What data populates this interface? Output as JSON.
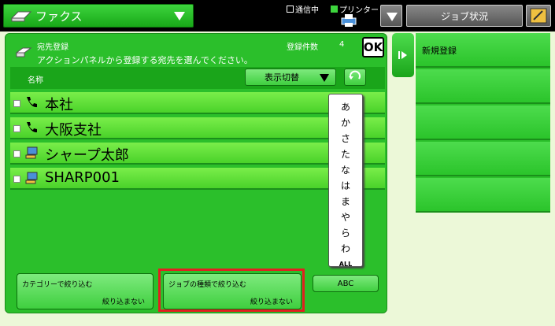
{
  "topbar": {
    "mode_label": "ファクス",
    "status_comm": "通信中",
    "status_printer": "プリンター",
    "job_status_label": "ジョブ状況"
  },
  "panel": {
    "title": "宛先登録",
    "subtitle": "アクションパネルから登録する宛先を選んでください。",
    "count_label": "登録件数",
    "count_value": "4",
    "ok_label": "OK",
    "column_label": "名称",
    "view_switch_label": "表示切替"
  },
  "rows": [
    {
      "name": "本社",
      "icon": "phone-icon"
    },
    {
      "name": "大阪支社",
      "icon": "phone-icon"
    },
    {
      "name": "シャープ太郎",
      "icon": "computer-icon"
    },
    {
      "name": "SHARP001",
      "icon": "computer-icon"
    }
  ],
  "kana_index": [
    "あ",
    "か",
    "さ",
    "た",
    "な",
    "は",
    "ま",
    "や",
    "ら",
    "わ",
    "ALL"
  ],
  "filters": {
    "category_title": "カテゴリーで絞り込む",
    "category_value": "絞り込まない",
    "jobtype_title": "ジョブの種類で絞り込む",
    "jobtype_value": "絞り込まない",
    "abc_label": "ABC"
  },
  "side": {
    "new_register_label": "新規登録"
  },
  "colors": {
    "panel_green": "#2bbf2b",
    "highlight_red": "#e02020",
    "background": "#ecf8d8"
  }
}
